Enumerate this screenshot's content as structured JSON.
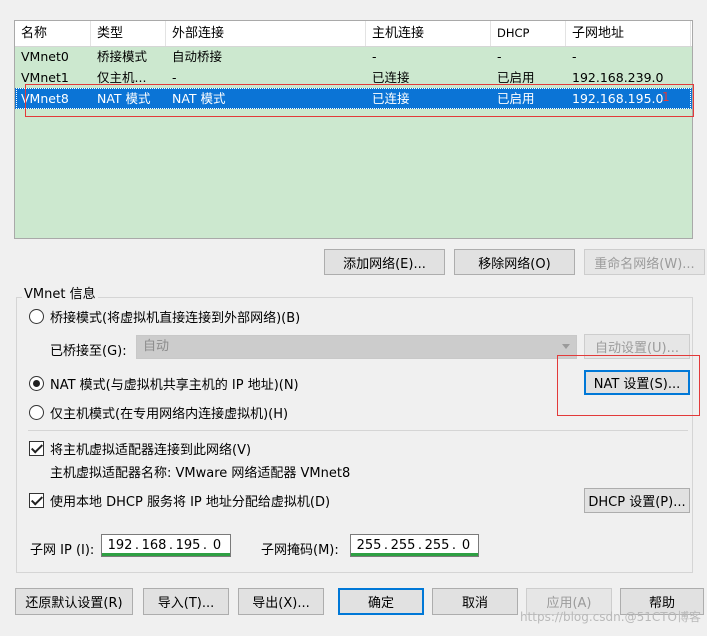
{
  "table": {
    "columns": [
      "名称",
      "类型",
      "外部连接",
      "主机连接",
      "DHCP",
      "子网地址"
    ],
    "rows": [
      {
        "name": "VMnet0",
        "type": "桥接模式",
        "external": "自动桥接",
        "host": "-",
        "dhcp": "-",
        "subnet": "-"
      },
      {
        "name": "VMnet1",
        "type": "仅主机...",
        "external": "-",
        "host": "已连接",
        "dhcp": "已启用",
        "subnet": "192.168.239.0"
      },
      {
        "name": "VMnet8",
        "type": "NAT 模式",
        "external": "NAT 模式",
        "host": "已连接",
        "dhcp": "已启用",
        "subnet": "192.168.195.0"
      }
    ],
    "selected_row": 2,
    "annotation_mark": "1"
  },
  "network_buttons": {
    "add": "添加网络(E)...",
    "remove": "移除网络(O)",
    "rename": "重命名网络(W)..."
  },
  "vmnet_info": {
    "group_label": "VMnet 信息",
    "bridged_radio": "桥接模式(将虚拟机直接连接到外部网络)(B)",
    "bridged_to_label": "已桥接至(G):",
    "bridged_to_value": "自动",
    "auto_settings_button": "自动设置(U)...",
    "nat_radio": "NAT 模式(与虚拟机共享主机的 IP 地址)(N)",
    "nat_settings_button": "NAT 设置(S)...",
    "hostonly_radio": "仅主机模式(在专用网络内连接虚拟机)(H)",
    "connect_adapter_check": "将主机虚拟适配器连接到此网络(V)",
    "adapter_name_text": "主机虚拟适配器名称: VMware 网络适配器 VMnet8",
    "dhcp_check": "使用本地 DHCP 服务将 IP 地址分配给虚拟机(D)",
    "dhcp_settings_button": "DHCP 设置(P)...",
    "subnet_ip_label": "子网 IP (I):",
    "subnet_ip": [
      "192",
      "168",
      "195",
      "0"
    ],
    "subnet_mask_label": "子网掩码(M):",
    "subnet_mask": [
      "255",
      "255",
      "255",
      "0"
    ]
  },
  "footer": {
    "restore": "还原默认设置(R)",
    "import": "导入(T)...",
    "export": "导出(X)...",
    "ok": "确定",
    "cancel": "取消",
    "apply": "应用(A)",
    "help": "帮助"
  },
  "watermark": "https://blog.csdn.@51CTO博客"
}
